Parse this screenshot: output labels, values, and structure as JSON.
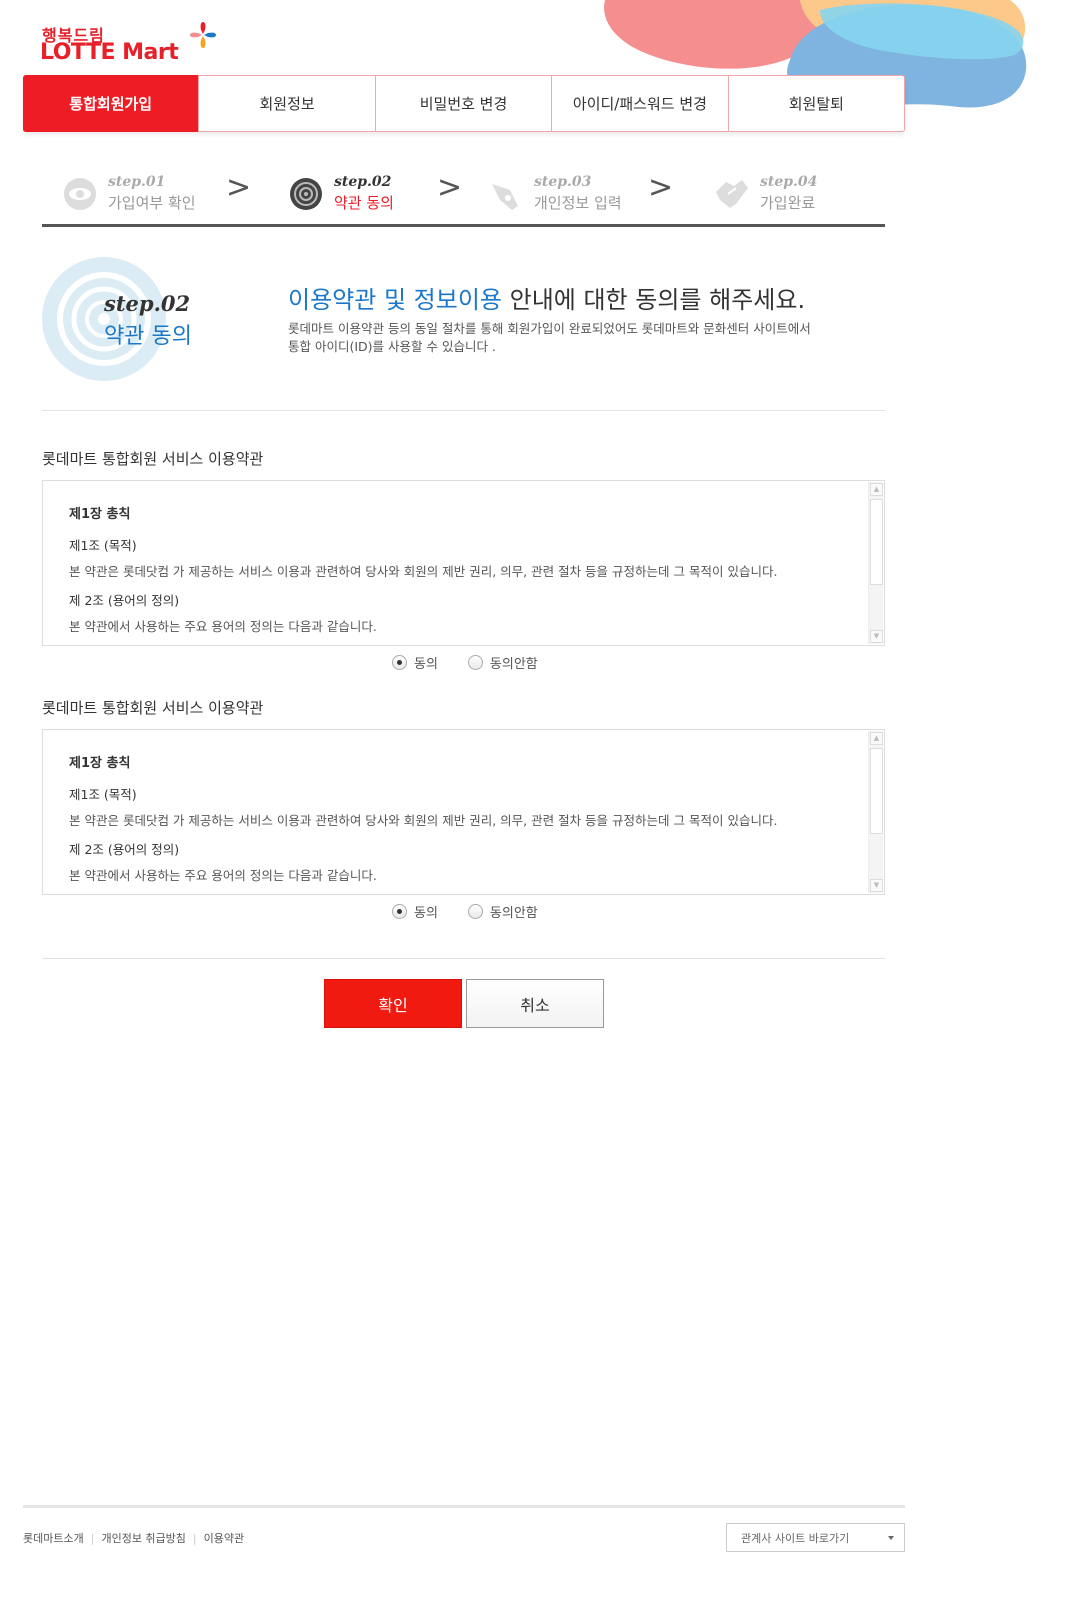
{
  "brand": {
    "sub": "행복드림",
    "name_lotte": "LOTTE",
    "name_mart": "Mart",
    "colors": {
      "red": "#ee1c25",
      "blue": "#1b78c8"
    }
  },
  "nav": {
    "items": [
      {
        "label": "통합회원가입",
        "active": true
      },
      {
        "label": "회원정보"
      },
      {
        "label": "비밀번호 변경"
      },
      {
        "label": "아이디/패스워드 변경"
      },
      {
        "label": "회원탈퇴"
      }
    ]
  },
  "steps": [
    {
      "num": "step.01",
      "label": "가입여부 확인",
      "icon": "eye-icon"
    },
    {
      "num": "step.02",
      "label": "약관 동의",
      "icon": "spiral-icon",
      "active": true
    },
    {
      "num": "step.03",
      "label": "개인정보 입력",
      "icon": "pen-icon"
    },
    {
      "num": "step.04",
      "label": "가입완료",
      "icon": "handshake-icon"
    }
  ],
  "step_arrow": ">",
  "intro": {
    "step": "step.02",
    "label": "약관 동의",
    "title_highlight": "이용약관 및 정보이용",
    "title_rest": " 안내에 대한 동의를 해주세요.",
    "desc_line1": "롯데마트 이용약관 등의 동일 절차를  통해 회원가입이 완료되었어도 롯데마트와 문화센터 사이트에서",
    "desc_line2": "통합 아이디(ID)를 사용할 수 있습니다 ."
  },
  "terms": [
    {
      "title": "롯데마트 통합회원 서비스 이용약관",
      "chapter": "제1장 총칙",
      "article1": "제1조 (목적)",
      "text1": "본 약관은 롯데닷컴 가 제공하는 서비스 이용과 관련하여 당사와 회원의 제반 권리, 의무, 관련 절차 등을 규정하는데 그 목적이 있습니다.",
      "article2": "제 2조 (용어의 정의)",
      "text2": "본 약관에서 사용하는 주요 용어의 정의는 다음과 같습니다.",
      "agree": "동의",
      "disagree": "동의안함",
      "selected": "agree"
    },
    {
      "title": "롯데마트 통합회원 서비스 이용약관",
      "chapter": "제1장 총칙",
      "article1": "제1조 (목적)",
      "text1": "본 약관은 롯데닷컴 가 제공하는 서비스 이용과 관련하여 당사와 회원의 제반 권리, 의무, 관련 절차 등을 규정하는데 그 목적이 있습니다.",
      "article2": "제 2조 (용어의 정의)",
      "text2": "본 약관에서 사용하는 주요 용어의 정의는 다음과 같습니다.",
      "agree": "동의",
      "disagree": "동의안함",
      "selected": "agree"
    }
  ],
  "buttons": {
    "confirm": "확인",
    "cancel": "취소"
  },
  "footer": {
    "links": [
      "롯데마트소개",
      "개인정보 취급방침",
      "이용약관"
    ],
    "family_site": "관계사 사이트 바로가기"
  }
}
